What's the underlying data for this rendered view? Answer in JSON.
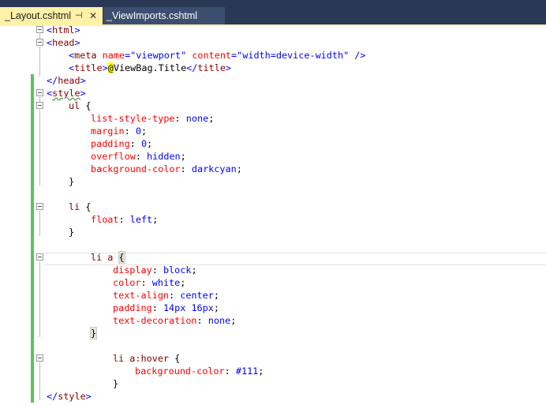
{
  "tabs": [
    {
      "label": "_Layout.cshtml",
      "active": true,
      "pin_icon": "pin-icon",
      "close_icon": "close-icon"
    },
    {
      "label": "_ViewImports.cshtml",
      "active": false
    }
  ],
  "colors": {
    "tabbar": "#293955",
    "active_tab": "#fff1a8",
    "change_bar": "#57c45c",
    "html_tag": "#800000",
    "html_delim": "#0000ff",
    "attr": "#ff0000",
    "value": "#0000ff"
  },
  "code": {
    "l1": [
      "<",
      "html",
      ">"
    ],
    "l2": [
      "<",
      "head",
      ">"
    ],
    "l3": [
      "<",
      "meta",
      " ",
      "name",
      "=",
      "\"viewport\"",
      " ",
      "content",
      "=",
      "\"width=device-width\"",
      " />"
    ],
    "l4": [
      "<",
      "title",
      ">",
      "@",
      "ViewBag.Title",
      "</",
      "title",
      ">"
    ],
    "l5": [
      "</",
      "head",
      ">"
    ],
    "l6": [
      "<",
      "style",
      ">"
    ],
    "l7": [
      "ul",
      " {"
    ],
    "l8": [
      "list-style-type",
      ": ",
      "none",
      ";"
    ],
    "l9": [
      "margin",
      ": ",
      "0",
      ";"
    ],
    "l10": [
      "padding",
      ": ",
      "0",
      ";"
    ],
    "l11": [
      "overflow",
      ": ",
      "hidden",
      ";"
    ],
    "l12": [
      "background-color",
      ": ",
      "darkcyan",
      ";"
    ],
    "l13": [
      "}"
    ],
    "l15": [
      "li",
      " {"
    ],
    "l16": [
      "float",
      ": ",
      "left",
      ";"
    ],
    "l17": [
      "}"
    ],
    "l19": [
      "li a",
      " ",
      "{"
    ],
    "l20": [
      "display",
      ": ",
      "block",
      ";"
    ],
    "l21": [
      "color",
      ": ",
      "white",
      ";"
    ],
    "l22": [
      "text-align",
      ": ",
      "center",
      ";"
    ],
    "l23": [
      "padding",
      ": ",
      "14px 16px",
      ";"
    ],
    "l24": [
      "text-decoration",
      ": ",
      "none",
      ";"
    ],
    "l25": [
      "}"
    ],
    "l27": [
      "li a:hover",
      " {"
    ],
    "l28": [
      "background-color",
      ": ",
      "#111",
      ";"
    ],
    "l29": [
      "}"
    ],
    "l30": [
      "</",
      "style",
      ">"
    ]
  }
}
